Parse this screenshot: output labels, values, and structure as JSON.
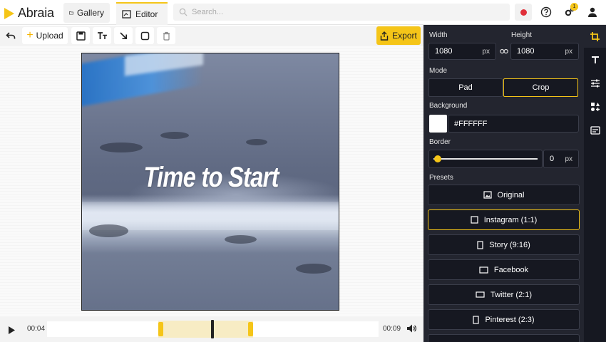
{
  "app": {
    "name": "Abraia"
  },
  "tabs": [
    {
      "label": "Gallery"
    },
    {
      "label": "Editor"
    }
  ],
  "search": {
    "placeholder": "Search..."
  },
  "notifications": {
    "count": "1"
  },
  "toolbar": {
    "upload_label": "Upload",
    "export_label": "Export"
  },
  "video": {
    "title": "Time to Start"
  },
  "timeline": {
    "current": "00:04",
    "duration": "00:09"
  },
  "panel": {
    "width_label": "Width",
    "height_label": "Height",
    "width_value": "1080",
    "height_value": "1080",
    "unit": "px",
    "mode_label": "Mode",
    "modes": [
      {
        "label": "Pad"
      },
      {
        "label": "Crop"
      }
    ],
    "active_mode": "Crop",
    "background_label": "Background",
    "background_value": "#FFFFFF",
    "border_label": "Border",
    "border_value": "0",
    "border_unit": "px",
    "presets_label": "Presets",
    "presets": [
      {
        "label": "Original",
        "icon": "image-icon"
      },
      {
        "label": "Instagram (1:1)",
        "icon": "square-icon"
      },
      {
        "label": "Story (9:16)",
        "icon": "portrait-icon"
      },
      {
        "label": "Facebook",
        "icon": "landscape-icon"
      },
      {
        "label": "Twitter (2:1)",
        "icon": "landscape-icon"
      },
      {
        "label": "Pinterest (2:3)",
        "icon": "portrait-icon"
      }
    ],
    "active_preset": "Instagram (1:1)"
  },
  "colors": {
    "accent": "#F5C518",
    "panel_bg": "#23252F",
    "rail_bg": "#161821",
    "record": "#E0303A"
  }
}
